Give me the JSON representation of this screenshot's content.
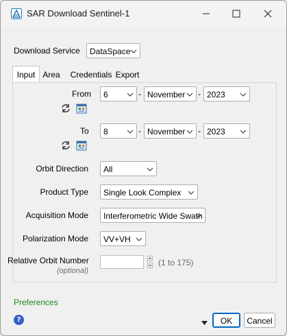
{
  "window": {
    "title": "SAR Download Sentinel-1"
  },
  "download_service": {
    "label": "Download Service",
    "value": "DataSpace"
  },
  "tabs": [
    {
      "label": "Input",
      "active": true
    },
    {
      "label": "Area"
    },
    {
      "label": "Credentials"
    },
    {
      "label": "Export"
    }
  ],
  "from": {
    "label": "From",
    "day": "6",
    "month": "November",
    "year": "2023",
    "separator": "-"
  },
  "to": {
    "label": "To",
    "day": "8",
    "month": "November",
    "year": "2023",
    "separator": "-"
  },
  "orbit_direction": {
    "label": "Orbit Direction",
    "value": "All"
  },
  "product_type": {
    "label": "Product Type",
    "value": "Single Look Complex"
  },
  "acquisition_mode": {
    "label": "Acquisition Mode",
    "value": "Interferometric Wide Swath"
  },
  "polarization_mode": {
    "label": "Polarization Mode",
    "value": "VV+VH"
  },
  "relative_orbit": {
    "label": "Relative Orbit Number",
    "optional": "(optional)",
    "value": "",
    "range_hint": "(1 to 175)"
  },
  "footer": {
    "preferences": "Preferences",
    "ok": "OK",
    "cancel": "Cancel",
    "help": "?"
  },
  "colors": {
    "link": "#1a8a1a",
    "accent": "#0067c0",
    "help_icon": "#3b5ec9"
  },
  "icons": [
    "app-icon",
    "minimize-icon",
    "maximize-icon",
    "close-icon",
    "refresh-icon",
    "calendar-icon",
    "chevron-down-icon",
    "help-icon"
  ]
}
